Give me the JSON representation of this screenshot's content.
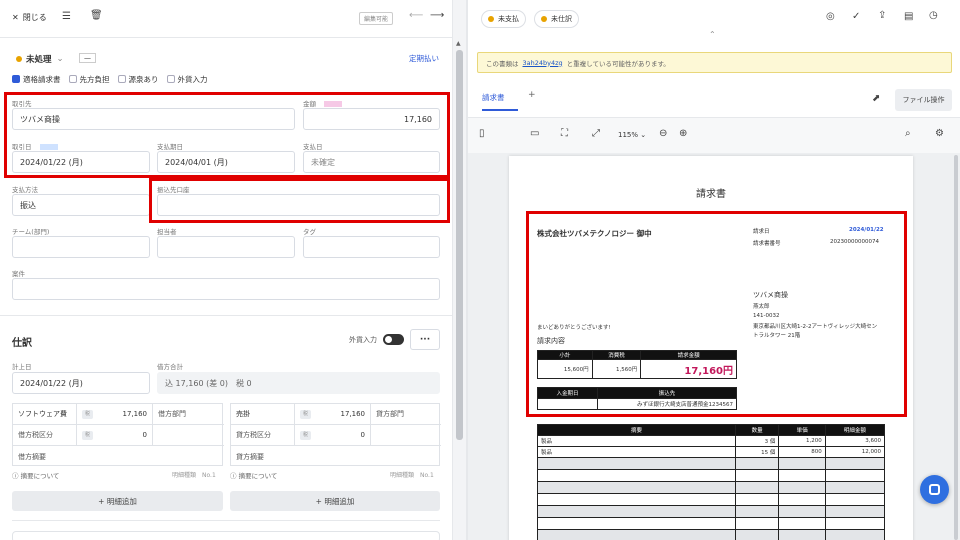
{
  "toolbar": {
    "close_label": "閉じる",
    "edit_badge": "編集可能"
  },
  "status": {
    "label": "未処理",
    "dash": "—",
    "periodic": "定期払い"
  },
  "checks": [
    {
      "label": "適格請求書",
      "on": true
    },
    {
      "label": "先方負担",
      "on": false
    },
    {
      "label": "源泉あり",
      "on": false
    },
    {
      "label": "外貨入力",
      "on": false
    }
  ],
  "fields": {
    "partner_label": "取引先",
    "partner_value": "ツバメ商操",
    "amount_label": "金額",
    "amount_value": "17,160",
    "txdate_label": "取引日",
    "txdate_value": "2024/01/22 (月)",
    "duedate_label": "支払期日",
    "duedate_value": "2024/04/01 (月)",
    "paydate_label": "支払日",
    "paydate_value": "未確定",
    "method_label": "支払方法",
    "method_value": "振込",
    "account_label": "振込先口座",
    "account_value": "",
    "team_label": "チーム(部門)",
    "person_label": "担当者",
    "tag_label": "タグ",
    "subject_label": "案件"
  },
  "journal": {
    "title": "仕訳",
    "fx_label": "外貨入力",
    "more": "···",
    "post_label": "計上日",
    "post_value": "2024/01/22 (月)",
    "total_label": "借方合計",
    "total_value": "込 17,160 (差 0)　税 0",
    "left": {
      "account": "ソフトウェア費",
      "amount": "17,160",
      "dept": "借方部門",
      "tax": "借方税区分",
      "tax_amount": "0",
      "memo": "借方摘要",
      "note": "ⓘ 摘要について",
      "line": "明細種類　No.1"
    },
    "right": {
      "account": "売掛",
      "amount": "17,160",
      "dept": "貸方部門",
      "tax": "貸方税区分",
      "tax_amount": "0",
      "memo": "貸方摘要",
      "note": "ⓘ 摘要について",
      "line": "明細種類　No.1"
    },
    "add_label": "+ 明細追加",
    "chip": "税"
  },
  "right": {
    "tags": [
      "未支払",
      "未仕訳"
    ],
    "notice_prefix": "この書類は",
    "notice_link": "3ah24by4zg",
    "notice_suffix": "と重複している可能性があります。",
    "tab_label": "請求書",
    "tab_add": "+",
    "file_op": "ファイル操作",
    "zoom": "115%"
  },
  "doc": {
    "title": "請求書",
    "company": "株式会社ツバメテクノロジー 御中",
    "date_label": "請求日",
    "date_value": "2024/01/22",
    "no_label": "請求書番号",
    "no_value": "20230000000074",
    "issuer": "ツバメ商操",
    "issuer_person": "燕太郎",
    "issuer_zip": "141-0032",
    "issuer_addr1": "東京都品川区大崎1-2-2アートヴィレッジ大崎セン",
    "issuer_addr2": "トラルタワー 21階",
    "thanks": "まいどありがとうございます!",
    "content_label": "請求内容",
    "sum_headers": [
      "小計",
      "消費税",
      "請求金額"
    ],
    "sum_values": [
      "15,600円",
      "1,560円",
      "17,160円"
    ],
    "bank_headers": [
      "入金期日",
      "振込先"
    ],
    "bank_value": "みずほ銀行大崎支店普通預金1234567",
    "item_headers": [
      "摘要",
      "数量",
      "単価",
      "明細金額"
    ],
    "items": [
      [
        "製品",
        "3 個",
        "1,200",
        "3,600"
      ],
      [
        "製品",
        "15 個",
        "800",
        "12,000"
      ]
    ]
  },
  "colors": {
    "accent": "#2f5bd8",
    "highlight_red": "#e00000",
    "brand_pink": "#c2185b"
  }
}
